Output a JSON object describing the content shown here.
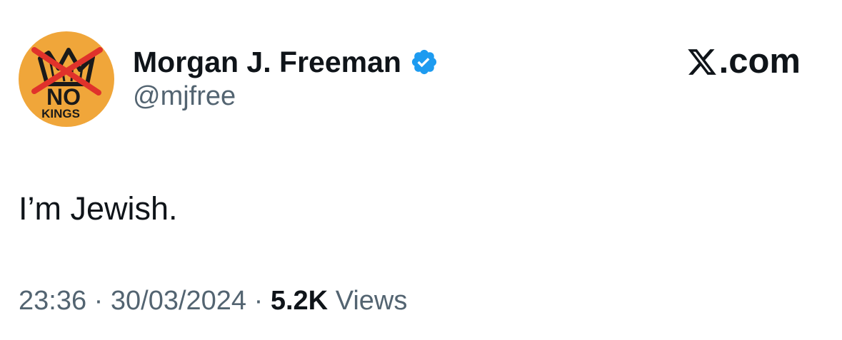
{
  "author": {
    "display_name": "Morgan J. Freeman",
    "handle": "@mjfree",
    "verified": true,
    "avatar": {
      "icon": "no-kings-crown-avatar",
      "text_top": "NO",
      "text_bottom": "KINGS",
      "background": "#f0a63a",
      "cross_color": "#e0322b"
    }
  },
  "brand": {
    "icon": "x-logo-icon",
    "label": ".com"
  },
  "tweet": {
    "text": "I’m Jewish."
  },
  "meta": {
    "time": "23:36",
    "separator": "·",
    "date": "30/03/2024",
    "views_count": "5.2K",
    "views_label": "Views"
  },
  "colors": {
    "verified_badge": "#1d9bf0",
    "text_primary": "#0f1419",
    "text_secondary": "#536471"
  }
}
